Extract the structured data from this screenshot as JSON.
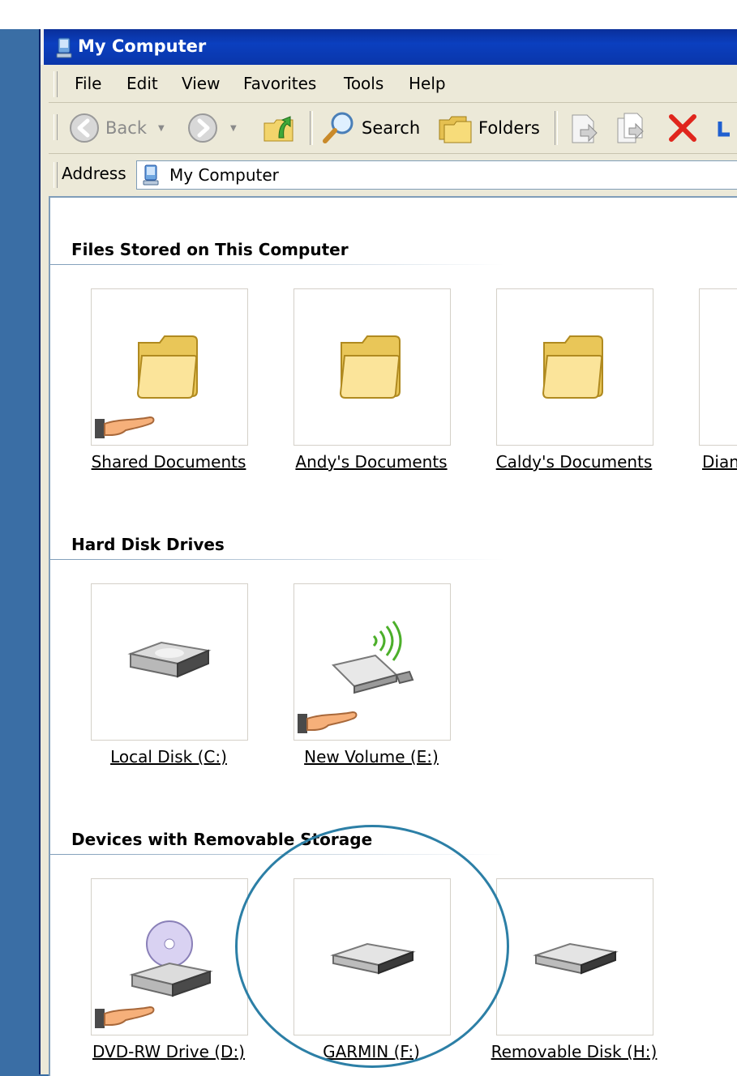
{
  "window": {
    "title": "My Computer"
  },
  "menu": [
    "File",
    "Edit",
    "View",
    "Favorites",
    "Tools",
    "Help"
  ],
  "toolbar": {
    "back_label": "Back",
    "search_label": "Search",
    "folders_label": "Folders"
  },
  "address": {
    "label": "Address",
    "value": "My Computer"
  },
  "groups": {
    "files": {
      "header": "Files Stored on This Computer",
      "items": [
        "Shared Documents",
        "Andy's Documents",
        "Caldy's Documents",
        "Dian"
      ]
    },
    "hard_disks": {
      "header": "Hard Disk Drives",
      "items": [
        "Local Disk (C:)",
        "New Volume (E:)"
      ]
    },
    "removable": {
      "header": "Devices with Removable Storage",
      "items": [
        "DVD-RW Drive (D:)",
        "GARMIN (F:)",
        "Removable Disk (H:)"
      ]
    }
  },
  "colors": {
    "titlebar": "#0a36aa",
    "desktop": "#3a6ea5",
    "highlight_circle": "#2c7fa6"
  }
}
